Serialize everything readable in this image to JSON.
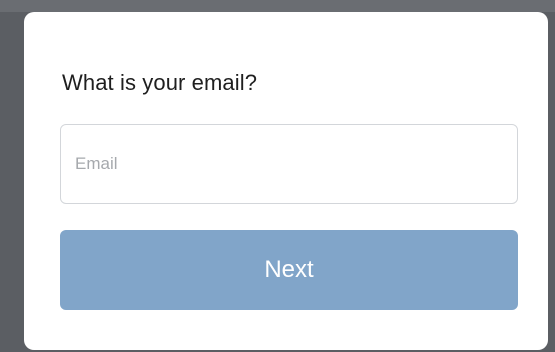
{
  "form": {
    "title": "What is your email?",
    "email_placeholder": "Email",
    "email_value": "",
    "next_label": "Next"
  },
  "colors": {
    "background": "#5b5e63",
    "card": "#ffffff",
    "button": "#81a5c9",
    "button_text": "#ffffff",
    "input_border": "#d3d6da",
    "placeholder": "#a6a9ad"
  }
}
